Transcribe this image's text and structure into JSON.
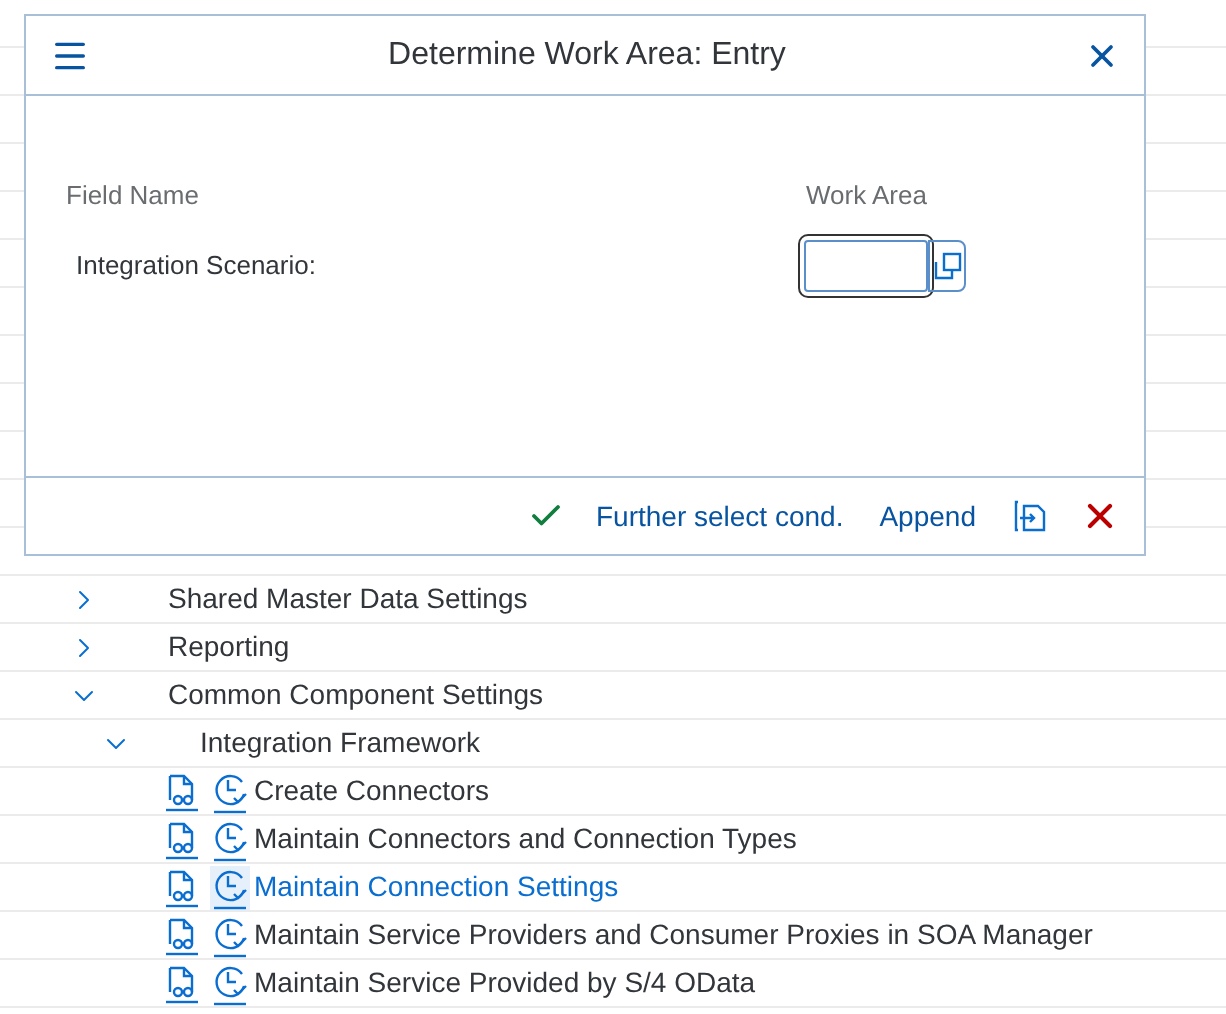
{
  "dialog": {
    "title": "Determine Work Area: Entry",
    "columns": [
      "Field Name",
      "Work Area"
    ],
    "fields": [
      {
        "label": "Integration Scenario:"
      }
    ],
    "footer": [
      {
        "kind": "confirm"
      },
      {
        "kind": "link",
        "label": "Further select cond."
      },
      {
        "kind": "link",
        "label": "Append"
      },
      {
        "kind": "transfer"
      },
      {
        "kind": "cancel"
      }
    ]
  },
  "tree": [
    {
      "label": "Shared Master Data Settings",
      "expanded": false
    },
    {
      "label": "Reporting",
      "expanded": false
    },
    {
      "label": "Common Component Settings",
      "expanded": true,
      "children": [
        {
          "label": "Integration Framework",
          "expanded": true,
          "children": [
            {
              "label": "Create Connectors",
              "selected": false
            },
            {
              "label": "Maintain Connectors and Connection Types",
              "selected": false
            },
            {
              "label": "Maintain Connection Settings",
              "selected": true
            },
            {
              "label": "Maintain Service Providers and Consumer Proxies in SOA Manager",
              "selected": false
            },
            {
              "label": "Maintain Service Provided by S/4 OData",
              "selected": false
            }
          ]
        }
      ]
    }
  ]
}
